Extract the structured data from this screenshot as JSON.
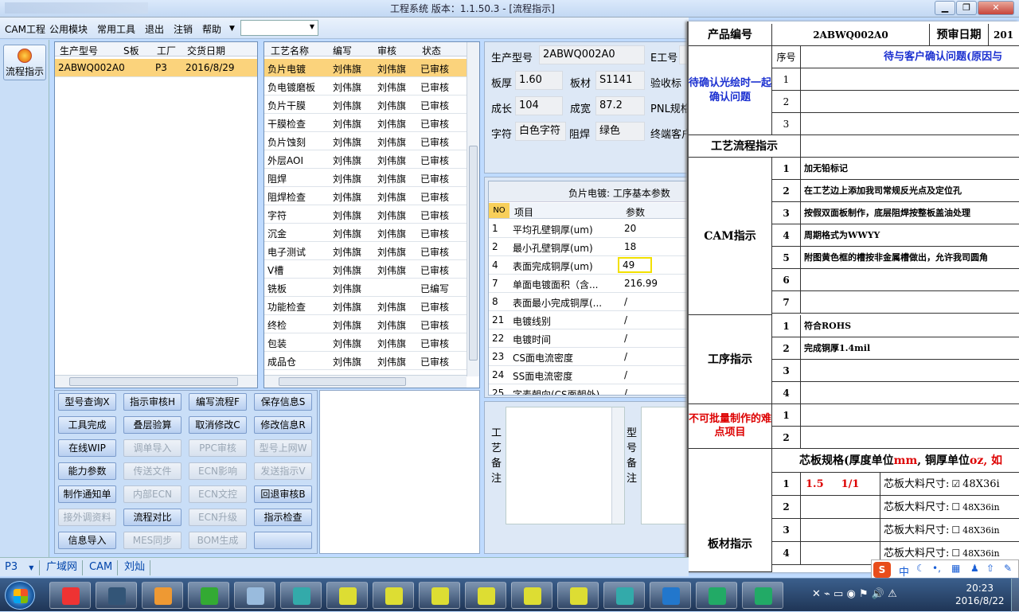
{
  "window": {
    "title": "工程系统  版本：1.1.50.3 - [流程指示]"
  },
  "menu": {
    "items": [
      "CAM工程",
      "公用模块",
      "常用工具",
      "退出",
      "注销",
      "帮助"
    ]
  },
  "sidebar": {
    "flow_button": "流程指示"
  },
  "parts_table": {
    "headers": [
      "生产型号",
      "S板",
      "工厂",
      "交货日期"
    ],
    "rows": [
      [
        "2ABWQ002A0",
        "",
        "P3",
        "2016/8/29"
      ]
    ]
  },
  "process_table": {
    "headers": [
      "工艺名称",
      "编写",
      "审核",
      "状态"
    ],
    "rows": [
      [
        "负片电镀",
        "刘伟旗",
        "刘伟旗",
        "已审核"
      ],
      [
        "负电镀磨板",
        "刘伟旗",
        "刘伟旗",
        "已审核"
      ],
      [
        "负片干膜",
        "刘伟旗",
        "刘伟旗",
        "已审核"
      ],
      [
        "干膜检查",
        "刘伟旗",
        "刘伟旗",
        "已审核"
      ],
      [
        "负片蚀刻",
        "刘伟旗",
        "刘伟旗",
        "已审核"
      ],
      [
        "外层AOI",
        "刘伟旗",
        "刘伟旗",
        "已审核"
      ],
      [
        "阻焊",
        "刘伟旗",
        "刘伟旗",
        "已审核"
      ],
      [
        "阻焊检查",
        "刘伟旗",
        "刘伟旗",
        "已审核"
      ],
      [
        "字符",
        "刘伟旗",
        "刘伟旗",
        "已审核"
      ],
      [
        "沉金",
        "刘伟旗",
        "刘伟旗",
        "已审核"
      ],
      [
        "电子测试",
        "刘伟旗",
        "刘伟旗",
        "已审核"
      ],
      [
        "V槽",
        "刘伟旗",
        "刘伟旗",
        "已审核"
      ],
      [
        "铣板",
        "刘伟旗",
        "",
        "已编写"
      ],
      [
        "功能检查",
        "刘伟旗",
        "刘伟旗",
        "已审核"
      ],
      [
        "终检",
        "刘伟旗",
        "刘伟旗",
        "已审核"
      ],
      [
        "包装",
        "刘伟旗",
        "刘伟旗",
        "已审核"
      ],
      [
        "成品仓",
        "刘伟旗",
        "刘伟旗",
        "已审核"
      ]
    ]
  },
  "buttons": [
    [
      "型号查询X",
      "指示审核H",
      "编写流程F",
      "保存信息S"
    ],
    [
      "工具完成",
      "叠层验算",
      "取消修改C",
      "修改信息R"
    ],
    [
      "在线WIP",
      "调单导入",
      "PPC审核",
      "型号上网W"
    ],
    [
      "能力参数",
      "传送文件",
      "ECN影响",
      "发送指示V"
    ],
    [
      "制作通知单",
      "内部ECN",
      "ECN文控",
      "回退审核B"
    ],
    [
      "接外调资料",
      "流程对比",
      "ECN升级",
      "指示检查"
    ],
    [
      "信息导入",
      "MES同步",
      "BOM生成",
      ""
    ]
  ],
  "info": {
    "model_label": "生产型号",
    "model_value": "2ABWQ002A0",
    "e_label": "E工号",
    "thick_label": "板厚",
    "thick_value": "1.60",
    "mat_label": "板材",
    "mat_value": "S1141",
    "accept_label": "验收标",
    "len_label": "成长",
    "len_value": "104",
    "wid_label": "成宽",
    "wid_value": "87.2",
    "pnl_label": "PNL规格",
    "char_label": "字符",
    "char_value": "白色字符",
    "mask_label": "阻焊",
    "mask_value": "绿色",
    "client_label": "终端客户"
  },
  "params": {
    "title": "负片电镀: 工序基本参数",
    "headers": [
      "NO",
      "项目",
      "参数"
    ],
    "rows": [
      [
        "1",
        "平均孔壁铜厚(um)",
        "20"
      ],
      [
        "2",
        "最小孔壁铜厚(um)",
        "18"
      ],
      [
        "4",
        "表面完成铜厚(um)",
        "49"
      ],
      [
        "7",
        "单面电镀面积（含...",
        "216.99"
      ],
      [
        "8",
        "表面最小完成铜厚(...",
        "/"
      ],
      [
        "21",
        "电镀线别",
        "/"
      ],
      [
        "22",
        "电镀时间",
        "/"
      ],
      [
        "23",
        "CS面电流密度",
        "/"
      ],
      [
        "24",
        "SS面电流密度",
        "/"
      ],
      [
        "25",
        "字麦朝向(CS面朝外)",
        "/"
      ]
    ]
  },
  "notes": {
    "process_label": "工艺备注",
    "model_label": "型号备注"
  },
  "status": {
    "factory": "P3",
    "tabs": [
      "广域网",
      "CAM",
      "刘灿"
    ]
  },
  "doc": {
    "product_label": "产品编号",
    "product_value": "2ABWQ002A0",
    "date_label": "预审日期",
    "date_value": "201",
    "seq_label": "序号",
    "confirm_title": "待与客户确认问题(原因与",
    "confirm_side": "待确认光绘时一起确认问题",
    "flow_label": "工艺流程指示",
    "cam_label": "CAM指示",
    "cam_rows": [
      "加无铅标记",
      "在工艺边上添加我司常规反光点及定位孔",
      "按假双面板制作，底层阻焊按整板盖油处理",
      "周期格式为WWYY",
      "附图黄色框的槽按非金属槽做出，允许我司圆角"
    ],
    "proc_label": "工序指示",
    "proc_rows": [
      "符合ROHS",
      "完成铜厚1.4mil"
    ],
    "difficult_label": "不可批量制作的难点项目",
    "core_title_a": "芯板规格(厚度单位",
    "core_title_b": "mm",
    "core_title_c": ", 铜厚单位",
    "core_title_d": "oz",
    "core_title_e": ", 如",
    "board_label": "板材指示",
    "core_row1_a": "1.5",
    "core_row1_b": "1/1",
    "core_size_label": "芯板大料尺寸:",
    "core_sizes": [
      "48X36i",
      "48X36in",
      "48X36in",
      "48X36in"
    ]
  },
  "taskbar": {
    "time": "20:23",
    "date": "2016/8/22"
  },
  "ime": {
    "lang": "中"
  }
}
